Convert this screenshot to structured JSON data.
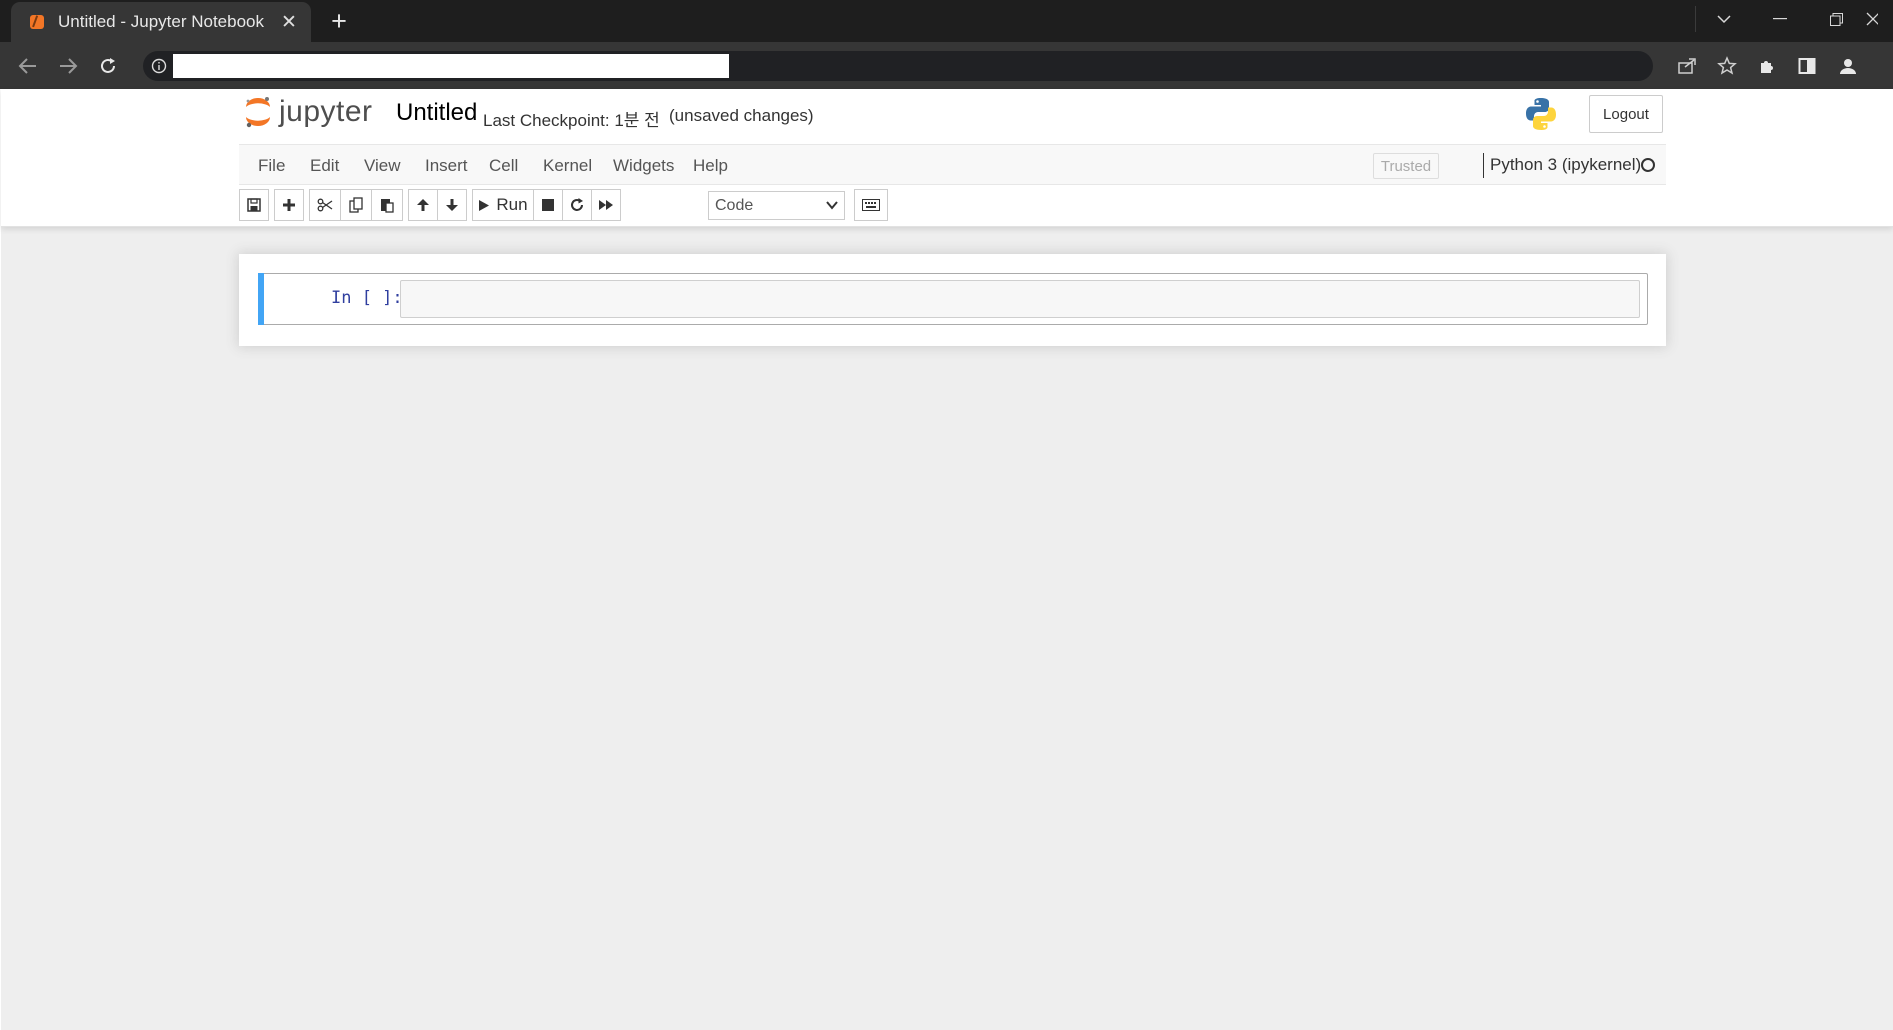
{
  "browser": {
    "tab_title": "Untitled - Jupyter Notebook",
    "tab_close": "✕",
    "new_tab": "+",
    "url": ""
  },
  "header": {
    "logo_text": "jupyter",
    "notebook_title": "Untitled",
    "checkpoint": "Last Checkpoint: 1분 전",
    "save_status": "(unsaved changes)",
    "logout_label": "Logout"
  },
  "menu": {
    "items": [
      "File",
      "Edit",
      "View",
      "Insert",
      "Cell",
      "Kernel",
      "Widgets",
      "Help"
    ],
    "trusted_label": "Trusted",
    "kernel_name": "Python 3 (ipykernel)"
  },
  "toolbar": {
    "run_label": "Run",
    "cell_type": "Code"
  },
  "cells": [
    {
      "prompt": "In [ ]:",
      "source": ""
    }
  ],
  "colors": {
    "selected_cell_bar": "#42a5f5",
    "prompt_text": "#303f9f",
    "jupyter_orange": "#f37626"
  }
}
